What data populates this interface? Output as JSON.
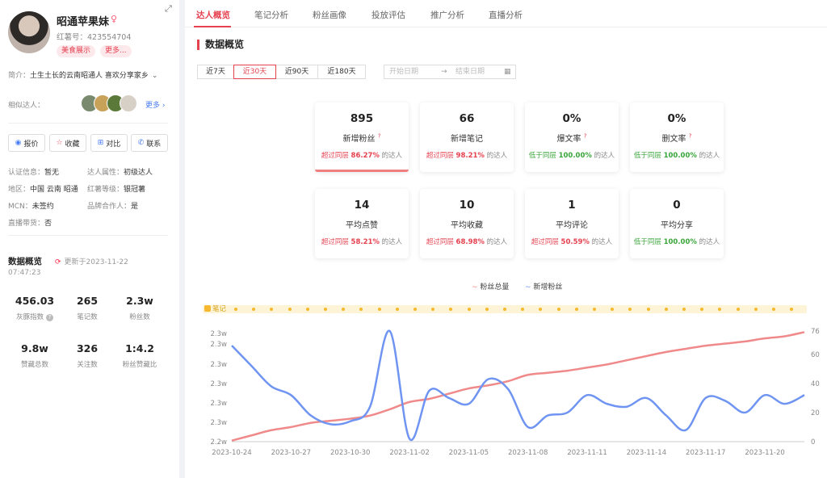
{
  "profile": {
    "name": "昭通苹果妹",
    "gender_icon": "female-icon",
    "red_id": "红薯号：423554704",
    "tags": [
      "美食展示",
      "更多..."
    ],
    "bio_key": "简介：",
    "bio": "土生土长的云南昭通人 喜欢分享家乡",
    "similar_key": "相似达人：",
    "similar_more": "更多"
  },
  "actions": [
    {
      "label": "报价",
      "icon": "quote-icon"
    },
    {
      "label": "收藏",
      "icon": "star-icon"
    },
    {
      "label": "对比",
      "icon": "compare-icon"
    },
    {
      "label": "联系",
      "icon": "phone-icon"
    }
  ],
  "info": {
    "auth_k": "认证信息：",
    "auth_v": "暂无",
    "attr_k": "达人属性：",
    "attr_v": "初级达人",
    "region_k": "地区：",
    "region_v": "中国 云南 昭通",
    "level_k": "红薯等级：",
    "level_v": "银冠薯",
    "mcn_k": "MCN：",
    "mcn_v": "未签约",
    "brand_k": "品牌合作人：",
    "brand_v": "是",
    "live_k": "直播带货：",
    "live_v": "否"
  },
  "overview": {
    "title": "数据概览",
    "updated": "更新于2023-11-22",
    "time": "07:47:23",
    "stats": [
      {
        "value": "456.03",
        "label": "灰豚指数"
      },
      {
        "value": "265",
        "label": "笔记数"
      },
      {
        "value": "2.3w",
        "label": "粉丝数"
      },
      {
        "value": "9.8w",
        "label": "赞藏总数"
      },
      {
        "value": "326",
        "label": "关注数"
      },
      {
        "value": "1:4.2",
        "label": "粉丝赞藏比"
      }
    ]
  },
  "tabs": [
    "达人概览",
    "笔记分析",
    "粉丝画像",
    "投放评估",
    "推广分析",
    "直播分析"
  ],
  "section_title": "数据概览",
  "ranges": [
    "近7天",
    "近30天",
    "近90天",
    "近180天"
  ],
  "date": {
    "start": "开始日期",
    "arrow": "→",
    "end": "结束日期"
  },
  "cards": [
    {
      "value": "895",
      "label": "新增粉丝",
      "help": "?",
      "w1": "超过同层",
      "pct": "86.27%",
      "w2": "的达人",
      "tone": "r"
    },
    {
      "value": "66",
      "label": "新增笔记",
      "help": "",
      "w1": "超过同层",
      "pct": "98.21%",
      "w2": "的达人",
      "tone": "r"
    },
    {
      "value": "0%",
      "label": "爆文率",
      "help": "?",
      "w1": "低于同层",
      "pct": "100.00%",
      "w2": "的达人",
      "tone": "g"
    },
    {
      "value": "0%",
      "label": "删文率",
      "help": "?",
      "w1": "低于同层",
      "pct": "100.00%",
      "w2": "的达人",
      "tone": "g"
    },
    {
      "value": "14",
      "label": "平均点赞",
      "help": "",
      "w1": "超过同层",
      "pct": "58.21%",
      "w2": "的达人",
      "tone": "r"
    },
    {
      "value": "10",
      "label": "平均收藏",
      "help": "",
      "w1": "超过同层",
      "pct": "68.98%",
      "w2": "的达人",
      "tone": "r"
    },
    {
      "value": "1",
      "label": "平均评论",
      "help": "",
      "w1": "超过同层",
      "pct": "50.59%",
      "w2": "的达人",
      "tone": "r"
    },
    {
      "value": "0",
      "label": "平均分享",
      "help": "",
      "w1": "低于同层",
      "pct": "100.00%",
      "w2": "的达人",
      "tone": "g"
    }
  ],
  "chart_data": {
    "type": "line",
    "legend": [
      "粉丝总量",
      "新增粉丝"
    ],
    "notes_label": "笔记",
    "x_ticks": [
      "2023-10-24",
      "2023-10-27",
      "2023-10-30",
      "2023-11-02",
      "2023-11-05",
      "2023-11-08",
      "2023-11-11",
      "2023-11-14",
      "2023-11-17",
      "2023-11-20"
    ],
    "y_left_ticks": [
      "2.2w",
      "2.3w",
      "2.3w",
      "2.3w",
      "2.3w",
      "2.3w",
      "2.3w"
    ],
    "y_right_ticks": [
      0,
      20,
      40,
      60,
      76
    ],
    "y_right_range": [
      0,
      76
    ],
    "series": [
      {
        "name": "粉丝总量",
        "color": "#f08a8a",
        "axis": "left",
        "values": [
          22110,
          22160,
          22210,
          22240,
          22280,
          22300,
          22320,
          22350,
          22410,
          22480,
          22510,
          22560,
          22610,
          22640,
          22680,
          22740,
          22760,
          22780,
          22810,
          22840,
          22880,
          22920,
          22960,
          22990,
          23020,
          23040,
          23060,
          23090,
          23110,
          23150
        ]
      },
      {
        "name": "新增粉丝",
        "color": "#6f94f2",
        "axis": "right",
        "values": [
          66,
          52,
          38,
          32,
          18,
          12,
          14,
          24,
          76,
          2,
          35,
          30,
          26,
          43,
          36,
          10,
          18,
          20,
          32,
          26,
          24,
          30,
          18,
          8,
          30,
          28,
          20,
          32,
          26,
          32
        ]
      }
    ],
    "y_left_range": [
      22100,
      23160
    ]
  }
}
